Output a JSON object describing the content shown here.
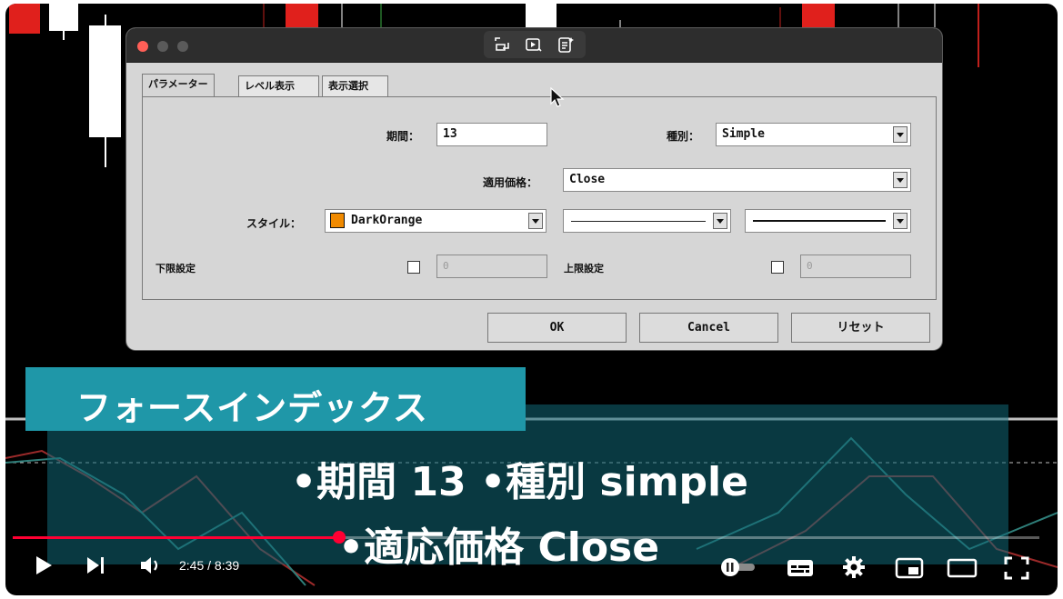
{
  "dialog": {
    "tabs": [
      "パラメーター",
      "レベル表示",
      "表示選択"
    ],
    "period_label": "期間：",
    "period_value": "13",
    "type_label": "種別：",
    "type_value": "Simple",
    "price_label": "適用価格：",
    "price_value": "Close",
    "style_label": "スタイル：",
    "style_color_name": "DarkOrange",
    "style_color": "#f08a00",
    "lower_label": "下限設定",
    "lower_value": "0",
    "upper_label": "上限設定",
    "upper_value": "0",
    "ok_label": "OK",
    "cancel_label": "Cancel",
    "reset_label": "リセット"
  },
  "overlay": {
    "title": "フォースインデックス",
    "line1": "•期間 13 •種別 simple",
    "line2": "•適応価格 Close"
  },
  "player": {
    "time": "2:45 / 8:39",
    "progress": 0.318,
    "accent": "#ff0033"
  }
}
